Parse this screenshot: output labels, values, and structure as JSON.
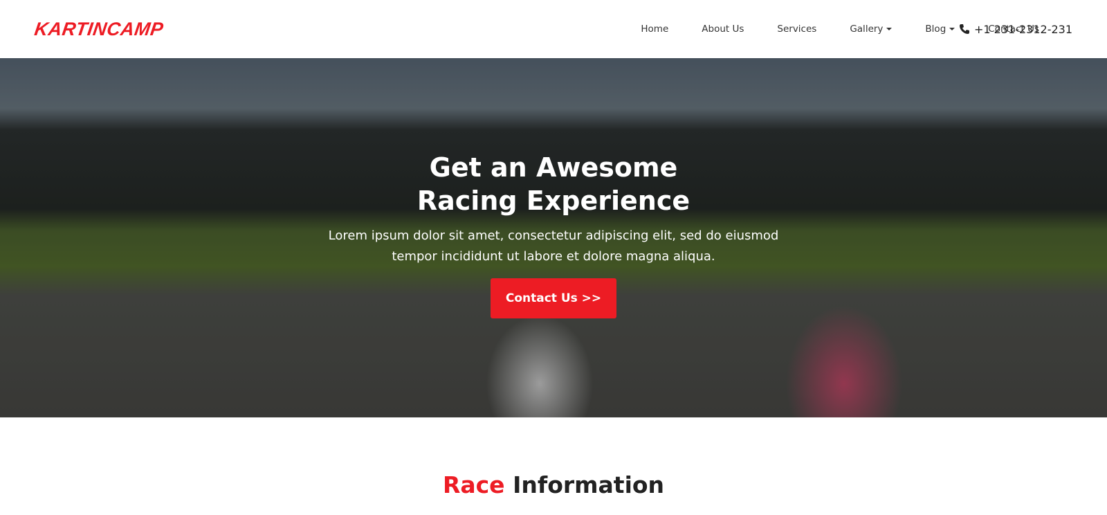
{
  "brand": {
    "logo": "KARTINCAMP",
    "accent": "#ed1c24"
  },
  "nav": {
    "items": [
      {
        "label": "Home"
      },
      {
        "label": "About Us"
      },
      {
        "label": "Services"
      },
      {
        "label": "Gallery",
        "dropdown": true
      },
      {
        "label": "Blog",
        "dropdown": true
      },
      {
        "label": "Contact Us"
      }
    ],
    "phone": "+1 231-2312-231",
    "phone_icon": "phone-icon"
  },
  "hero": {
    "title_line1": "Get an Awesome",
    "title_line2": "Racing Experience",
    "text_line1": "Lorem ipsum dolor sit amet, consectetur adipiscing elit, sed do eiusmod",
    "text_line2": "tempor incididunt ut labore et dolore magna aliqua.",
    "button": "Contact Us >>"
  },
  "section": {
    "title_highlight": "Race",
    "title_rest": "Information"
  }
}
